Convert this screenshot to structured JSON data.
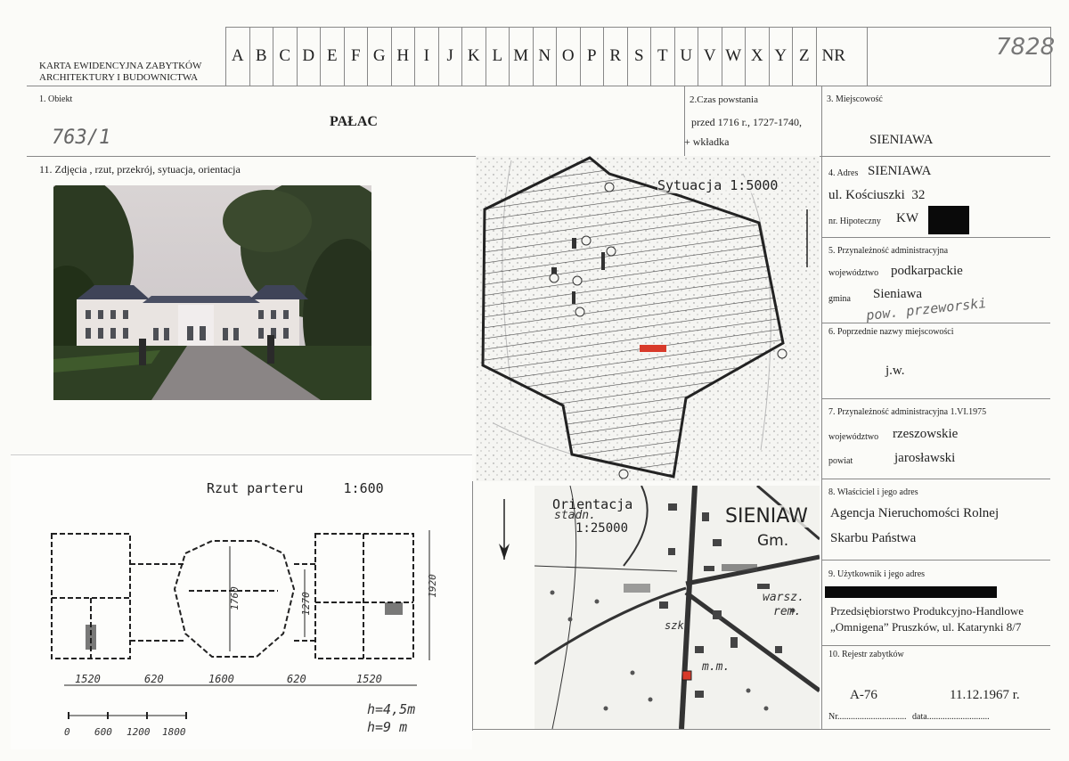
{
  "header": {
    "card_title_line1": "KARTA EWIDENCYJNA ZABYTKÓW",
    "card_title_line2": "ARCHITEKTURY I BUDOWNICTWA",
    "letters": [
      "A",
      "B",
      "C",
      "D",
      "E",
      "F",
      "G",
      "H",
      "I",
      "J",
      "K",
      "L",
      "M",
      "N",
      "O",
      "P",
      "R",
      "S",
      "T",
      "U",
      "V",
      "W",
      "X",
      "Y",
      "Z"
    ],
    "nr_label": "NR",
    "nr_handwritten": "7828"
  },
  "obiekt": {
    "label": "1. Obiekt",
    "value": "PAŁAC",
    "handwritten_ref": "763/1"
  },
  "czas_powstania": {
    "label": "2.Czas powstania",
    "line1": "przed 1716 r., 1727-1740,",
    "line2": "+ wkładka"
  },
  "miejscowosc": {
    "label": "3. Miejscowość",
    "value": "SIENIAWA"
  },
  "adres": {
    "label": "4. Adres",
    "city": "SIENIAWA",
    "street": "ul. Kościuszki  32",
    "hipoteczny_label": "nr. Hipoteczny",
    "kw": "KW"
  },
  "przynaleznosc": {
    "label": "5. Przynależność administracyjna",
    "woj_label": "województwo",
    "woj_value": "podkarpackie",
    "gmina_label": "gmina",
    "gmina_value": "Sieniawa",
    "pow_handwritten": "pow. przeworski"
  },
  "poprzednie_nazwy": {
    "label": "6. Poprzednie nazwy miejscowości",
    "value": "j.w."
  },
  "przynaleznosc_1975": {
    "label": "7. Przynależność administracyjna 1.VI.1975",
    "woj_label": "województwo",
    "woj_value": "rzeszowskie",
    "powiat_label": "powiat",
    "powiat_value": "jarosławski"
  },
  "wlasciciel": {
    "label": "8. Właściciel i jego adres",
    "line1": "Agencja Nieruchomości Rolnej",
    "line2": "Skarbu Państwa"
  },
  "uzytkownik": {
    "label": "9. Użytkownik i jego adres",
    "line1": "Przedsiębiorstwo Produkcyjno-Handlowe",
    "line2": "„Omnigena” Pruszków, ul. Katarynki 8/7"
  },
  "rejestr": {
    "label": "10. Rejestr zabytków",
    "number": "A-76",
    "date": "11.12.1967 r.",
    "nr_label": "Nr",
    "nr_dots": "...............................",
    "data_label": "data",
    "data_dots": "............................"
  },
  "zdjecia": {
    "label": "11. Zdjęcia , rzut, przekrój, sytuacja, orientacja"
  },
  "sytuacja_map": {
    "title": "Sytuacja 1:5000"
  },
  "orientacja_map": {
    "title_line1": "Orientacja",
    "title_line2": "1:25000",
    "place": "SIENIAW",
    "label_gm": "Gm.",
    "label_stadn": "stadn.",
    "label_warsz": "warsz.",
    "label_rem": "rem.",
    "label_mm": "m.m.",
    "label_szk": "szk."
  },
  "rzut": {
    "title": "Rzut parteru     1:600",
    "dim_1520_a": "1520",
    "dim_620_a": "620",
    "dim_1600": "1600",
    "dim_620_b": "620",
    "dim_1520_b": "1520",
    "dim_1760": "1760",
    "dim_1270": "1270",
    "dim_1920": "1920",
    "scale_0": "0",
    "scale_600": "600",
    "scale_1200": "1200",
    "scale_1800": "1800",
    "h1": "h=4,5m",
    "h2": "h=9 m"
  },
  "colors": {
    "ink": "#222222",
    "rule": "#888888",
    "redaction": "#0a0a0a",
    "marker_red": "#d83a2a"
  }
}
